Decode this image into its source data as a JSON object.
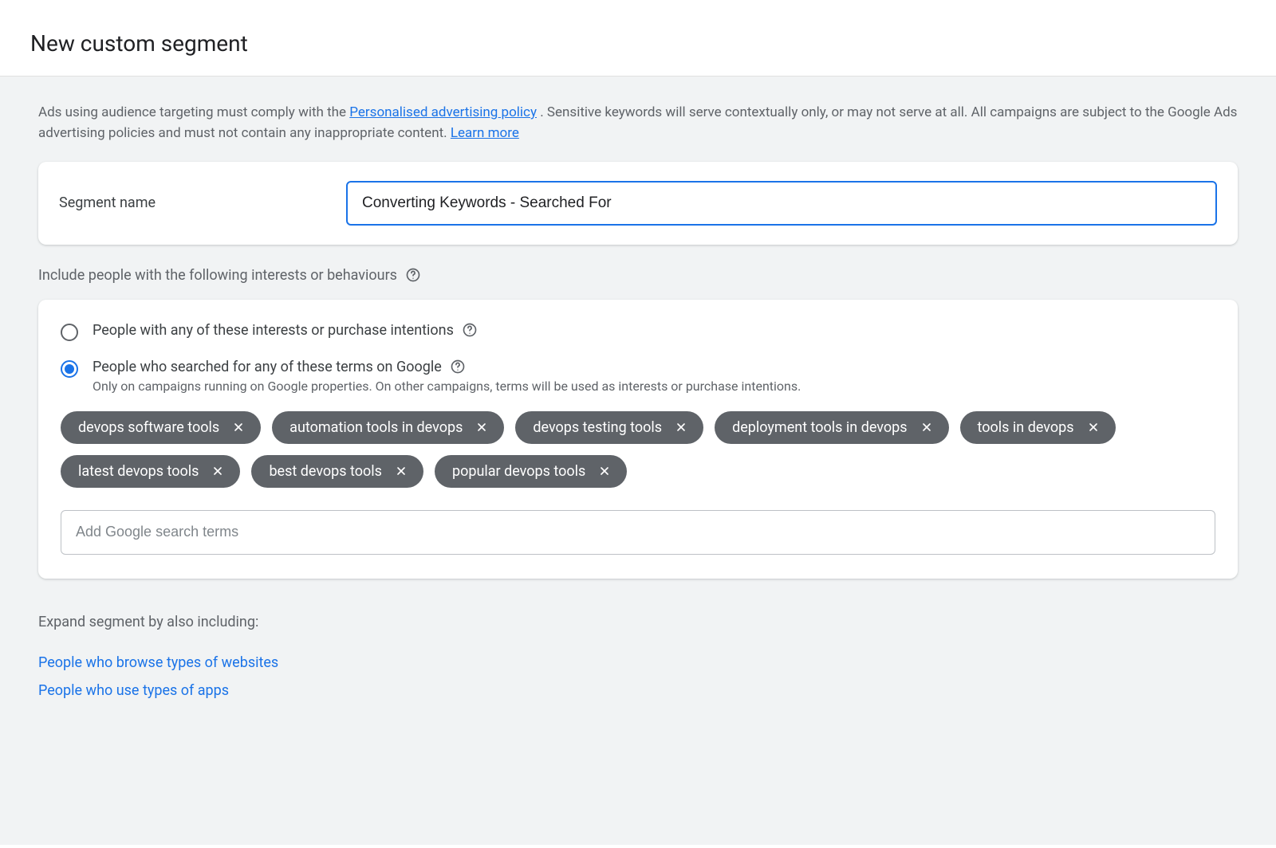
{
  "header": {
    "title": "New custom segment"
  },
  "policy": {
    "prefix": "Ads using audience targeting must comply with the ",
    "link1": "Personalised advertising policy",
    "middle": ". Sensitive keywords will serve contextually only, or may not serve at all. All campaigns are subject to the Google Ads advertising policies and must not contain any inappropriate content. ",
    "link2": "Learn more"
  },
  "segment": {
    "label": "Segment name",
    "value": "Converting Keywords - Searched For"
  },
  "include_label": "Include people with the following interests or behaviours",
  "radios": {
    "opt1": {
      "label": "People with any of these interests or purchase intentions"
    },
    "opt2": {
      "label": "People who searched for any of these terms on Google",
      "sub": "Only on campaigns running on Google properties. On other campaigns, terms will be used as interests or purchase intentions."
    },
    "selected": "opt2"
  },
  "chips": [
    "devops software tools",
    "automation tools in devops",
    "devops testing tools",
    "deployment tools in devops",
    "tools in devops",
    "latest devops tools",
    "best devops tools",
    "popular devops tools"
  ],
  "search_placeholder": "Add Google search terms",
  "expand": {
    "label": "Expand segment by also including:",
    "links": [
      "People who browse types of websites",
      "People who use types of apps"
    ]
  }
}
